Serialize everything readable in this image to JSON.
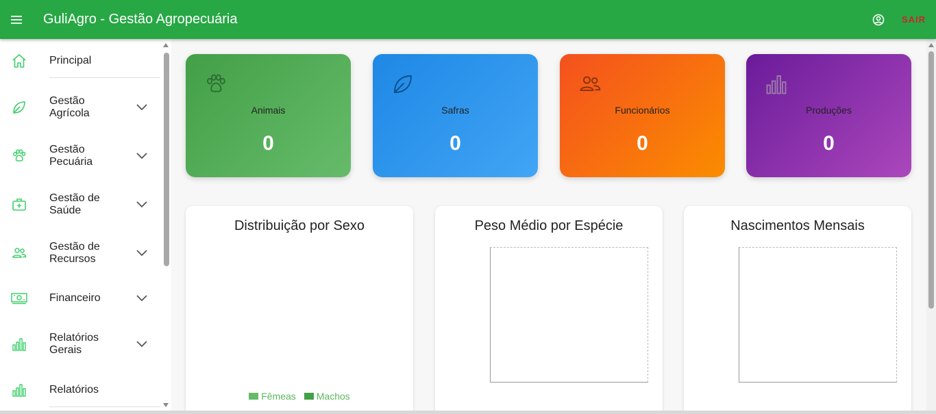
{
  "app": {
    "title": "GuliAgro - Gestão Agropecuária",
    "logout_label": "SAIR",
    "brand_color": "#28a745"
  },
  "sidebar": {
    "items": [
      {
        "label": "Principal",
        "icon": "home-icon"
      },
      {
        "label": "Gestão Agrícola",
        "icon": "leaf-icon"
      },
      {
        "label": "Gestão Pecuária",
        "icon": "paw-icon"
      },
      {
        "label": "Gestão de Saúde",
        "icon": "medical-kit-icon"
      },
      {
        "label": "Gestão de Recursos",
        "icon": "people-icon"
      },
      {
        "label": "Financeiro",
        "icon": "money-icon"
      },
      {
        "label": "Relatórios Gerais",
        "icon": "bar-chart-icon"
      },
      {
        "label": "Relatórios",
        "icon": "bar-chart-icon"
      }
    ]
  },
  "stats": [
    {
      "label": "Animais",
      "value": "0",
      "icon": "paw-icon",
      "gradient": [
        "#43a047",
        "#66bb6a"
      ]
    },
    {
      "label": "Safras",
      "value": "0",
      "icon": "leaf-icon",
      "gradient": [
        "#1e88e5",
        "#42a5f5"
      ]
    },
    {
      "label": "Funcionários",
      "value": "0",
      "icon": "people-icon",
      "gradient": [
        "#f4511e",
        "#fb8c00"
      ]
    },
    {
      "label": "Produções",
      "value": "0",
      "icon": "bar-chart-icon",
      "gradient": [
        "#6a1b9a",
        "#ab47bc"
      ]
    }
  ],
  "charts": {
    "sexo": {
      "title": "Distribuição por Sexo",
      "legend": [
        "Fêmeas",
        "Machos"
      ],
      "legend_colors": [
        "#66bb6a",
        "#43a047"
      ]
    },
    "peso": {
      "title": "Peso Médio por Espécie"
    },
    "nascimentos": {
      "title": "Nascimentos Mensais"
    }
  }
}
